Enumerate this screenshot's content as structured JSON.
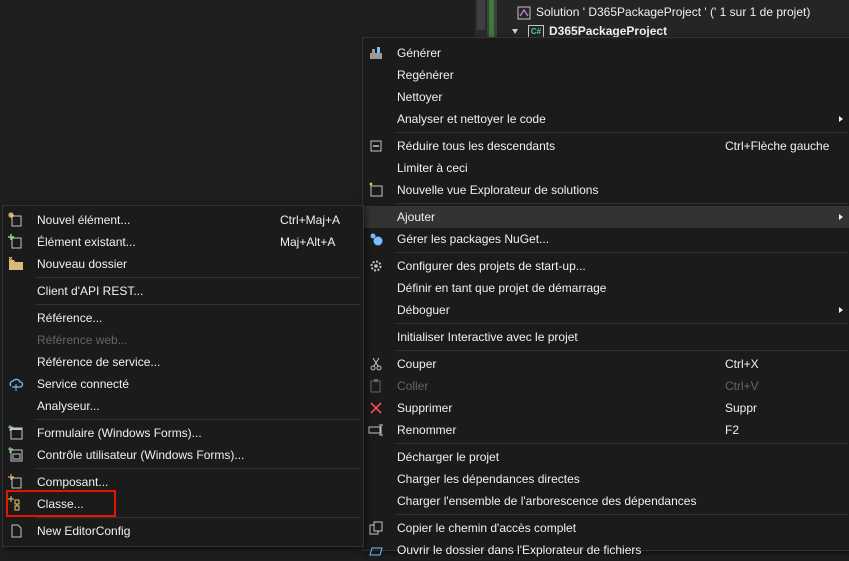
{
  "solution_explorer": {
    "solution_label": "Solution ' D365PackageProject ' (' 1 sur 1 de projet)",
    "project_label": "D365PackageProject",
    "project_badge": "C#"
  },
  "context_menu": {
    "items": [
      {
        "label": "Générer",
        "icon": "build-icon"
      },
      {
        "label": "Regénérer"
      },
      {
        "label": "Nettoyer"
      },
      {
        "label": "Analyser et nettoyer le code",
        "submenu": true
      },
      {
        "label": "Réduire tous les descendants",
        "icon": "collapse-icon",
        "shortcut": "Ctrl+Flèche gauche"
      },
      {
        "label": "Limiter à ceci"
      },
      {
        "label": "Nouvelle vue Explorateur de solutions",
        "icon": "new-view-icon"
      },
      {
        "label": "Ajouter",
        "submenu": true,
        "highlighted": true
      },
      {
        "label": "Gérer les packages NuGet...",
        "icon": "nuget-icon"
      },
      {
        "label": "Configurer des projets de start-up...",
        "icon": "gear-icon"
      },
      {
        "label": "Définir en tant que projet de démarrage"
      },
      {
        "label": "Déboguer",
        "submenu": true
      },
      {
        "label": "Initialiser Interactive avec le projet"
      },
      {
        "label": "Couper",
        "icon": "scissors-icon",
        "shortcut": "Ctrl+X"
      },
      {
        "label": "Coller",
        "icon": "paste-icon",
        "shortcut": "Ctrl+V",
        "disabled": true
      },
      {
        "label": "Supprimer",
        "icon": "delete-icon",
        "shortcut": "Suppr"
      },
      {
        "label": "Renommer",
        "icon": "rename-icon",
        "shortcut": "F2"
      },
      {
        "label": "Décharger le projet"
      },
      {
        "label": "Charger les dépendances directes"
      },
      {
        "label": "Charger l'ensemble de l'arborescence des dépendances"
      },
      {
        "label": "Copier le chemin d'accès complet",
        "icon": "copy-icon"
      },
      {
        "label": "Ouvrir le dossier dans l'Explorateur de fichiers",
        "icon": "open-folder-icon"
      }
    ]
  },
  "add_submenu": {
    "items": [
      {
        "label": "Nouvel élément...",
        "icon": "new-item-icon",
        "shortcut": "Ctrl+Maj+A"
      },
      {
        "label": "Élément existant...",
        "icon": "existing-item-icon",
        "shortcut": "Maj+Alt+A"
      },
      {
        "label": "Nouveau dossier",
        "icon": "folder-icon"
      },
      {
        "label": "Client d'API REST..."
      },
      {
        "label": "Référence..."
      },
      {
        "label": "Référence web...",
        "disabled": true
      },
      {
        "label": "Référence de service..."
      },
      {
        "label": "Service connecté",
        "icon": "connected-service-icon"
      },
      {
        "label": "Analyseur..."
      },
      {
        "label": "Formulaire (Windows Forms)...",
        "icon": "form-icon"
      },
      {
        "label": "Contrôle utilisateur (Windows Forms)...",
        "icon": "user-control-icon"
      },
      {
        "label": "Composant...",
        "icon": "component-icon"
      },
      {
        "label": "Classe...",
        "icon": "class-icon"
      },
      {
        "label": "New EditorConfig",
        "icon": "editorconfig-icon"
      }
    ]
  },
  "colors": {
    "menu_bg": "#1b1b1c",
    "highlight": "#333334",
    "disabled_text": "#656565",
    "annotation_box": "#e51400"
  }
}
